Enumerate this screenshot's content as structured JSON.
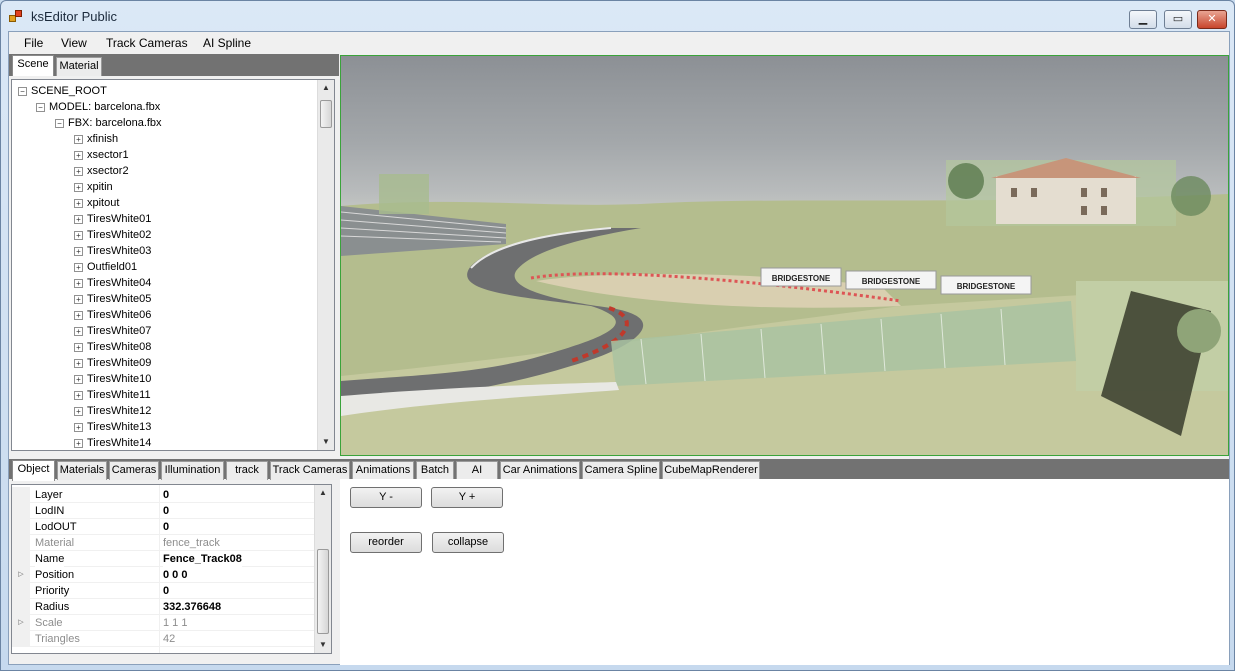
{
  "window": {
    "title": "ksEditor Public"
  },
  "menu": [
    "File",
    "View",
    "Track Cameras",
    "AI Spline"
  ],
  "scene_tabs": [
    "Scene",
    "Material"
  ],
  "tree": {
    "root": "SCENE_ROOT",
    "model": "MODEL: barcelona.fbx",
    "fbx": "FBX: barcelona.fbx",
    "nodes": [
      "xfinish",
      "xsector1",
      "xsector2",
      "xpitin",
      "xpitout",
      "TiresWhite01",
      "TiresWhite02",
      "TiresWhite03",
      "Outfield01",
      "TiresWhite04",
      "TiresWhite05",
      "TiresWhite06",
      "TiresWhite07",
      "TiresWhite08",
      "TiresWhite09",
      "TiresWhite10",
      "TiresWhite11",
      "TiresWhite12",
      "TiresWhite13",
      "TiresWhite14"
    ]
  },
  "viewport": {
    "billboards": [
      "BRIDGESTONE",
      "BRIDGESTONE",
      "BRIDGESTONE"
    ]
  },
  "object_tabs": [
    "Object",
    "Materials",
    "Cameras",
    "Illumination",
    "track",
    "Track Cameras",
    "Animations",
    "Batch",
    "AI",
    "Car Animations",
    "Camera Spline",
    "CubeMapRenderer"
  ],
  "properties": [
    {
      "name": "Layer",
      "value": "0"
    },
    {
      "name": "LodIN",
      "value": "0"
    },
    {
      "name": "LodOUT",
      "value": "0"
    },
    {
      "name": "Material",
      "value": "fence_track"
    },
    {
      "name": "Name",
      "value": "Fence_Track08"
    },
    {
      "name": "Position",
      "value": "0 0 0"
    },
    {
      "name": "Priority",
      "value": "0"
    },
    {
      "name": "Radius",
      "value": "332.376648"
    },
    {
      "name": "Scale",
      "value": "1 1 1"
    },
    {
      "name": "Triangles",
      "value": "42"
    }
  ],
  "buttons": {
    "y_minus": "Y -",
    "y_plus": "Y +",
    "reorder": "reorder",
    "collapse": "collapse"
  },
  "colors": {
    "viewport_border": "#3aa33a",
    "tab_strip": "#727272",
    "disabled_text": "#8d8d8d"
  }
}
